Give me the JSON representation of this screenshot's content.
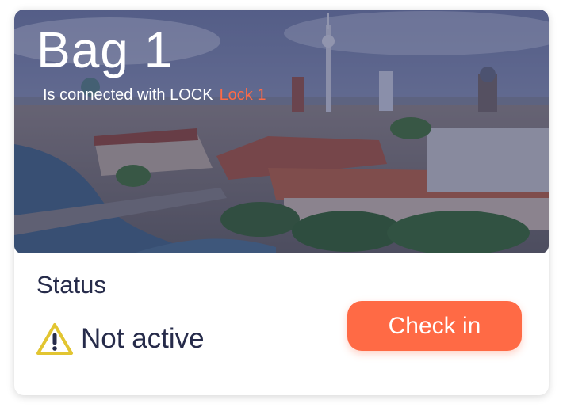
{
  "card": {
    "title": "Bag 1",
    "connected_text": "Is connected with LOCK",
    "lock_name": "Lock 1",
    "status_label": "Status",
    "status_value": "Not active",
    "status_icon": "warning-triangle-icon",
    "checkin_label": "Check in"
  },
  "colors": {
    "accent": "#ff6a45",
    "text_dark": "#262b4a",
    "warning": "#e2c531",
    "overlay": "#1e265a"
  }
}
